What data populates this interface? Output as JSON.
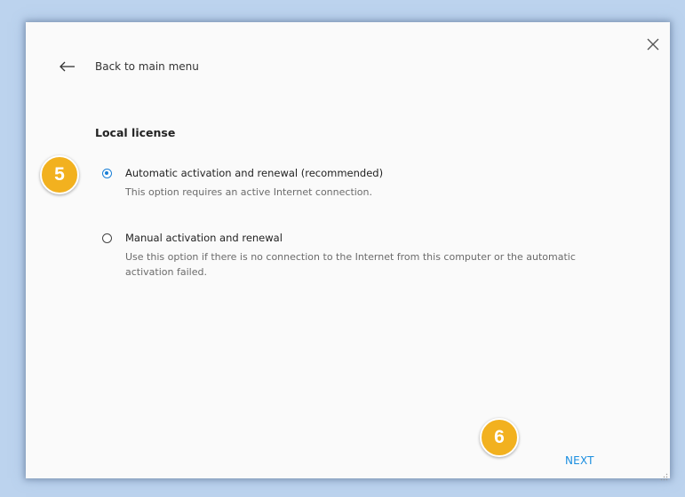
{
  "dialog": {
    "back_label": "Back to main menu",
    "section_title": "Local license",
    "options": [
      {
        "label": "Automatic activation and renewal (recommended)",
        "description": "This option requires an active Internet connection.",
        "selected": true
      },
      {
        "label": "Manual activation and renewal",
        "description": "Use this option if there is no connection to the Internet from this computer or the automatic activation failed.",
        "selected": false
      }
    ],
    "next_label": "NEXT"
  },
  "callouts": {
    "step_5": "5",
    "step_6": "6"
  },
  "icons": {
    "close": "close-icon",
    "back": "arrow-left-icon",
    "grip": "resize-grip-icon"
  },
  "colors": {
    "accent": "#1a7fd6",
    "link": "#1a8ee0",
    "callout": "#f2b11f",
    "backdrop": "#bcd3ee"
  }
}
